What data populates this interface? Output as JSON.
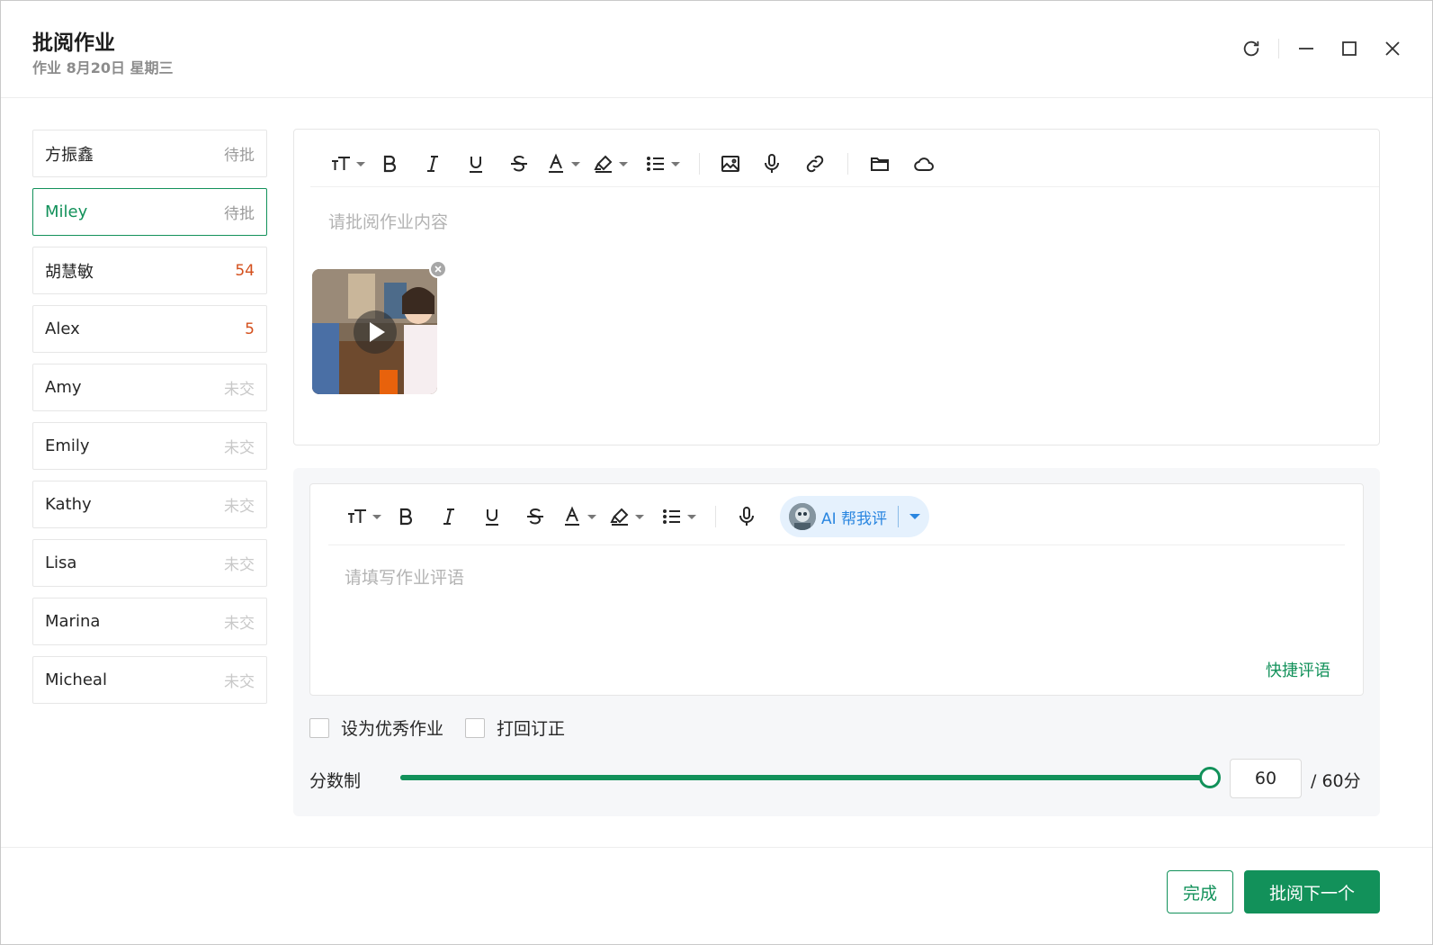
{
  "header": {
    "title": "批阅作业",
    "subtitle": "作业 8月20日 星期三"
  },
  "window_controls": [
    "refresh-icon",
    "minimize-icon",
    "maximize-icon",
    "close-icon"
  ],
  "students": [
    {
      "name": "方振鑫",
      "status": "待批",
      "kind": "pending"
    },
    {
      "name": "Miley",
      "status": "待批",
      "kind": "pending",
      "active": true
    },
    {
      "name": "胡慧敏",
      "status": "54",
      "kind": "score"
    },
    {
      "name": "Alex",
      "status": "5",
      "kind": "score"
    },
    {
      "name": "Amy",
      "status": "未交",
      "kind": "none"
    },
    {
      "name": "Emily",
      "status": "未交",
      "kind": "none"
    },
    {
      "name": "Kathy",
      "status": "未交",
      "kind": "none"
    },
    {
      "name": "Lisa",
      "status": "未交",
      "kind": "none"
    },
    {
      "name": "Marina",
      "status": "未交",
      "kind": "none"
    },
    {
      "name": "Micheal",
      "status": "未交",
      "kind": "none"
    }
  ],
  "content_editor": {
    "placeholder": "请批阅作业内容",
    "attachment": "video-thumbnail"
  },
  "comment_editor": {
    "placeholder": "请填写作业评语",
    "ai_button": "AI 帮我评",
    "quick_comments": "快捷评语"
  },
  "options": {
    "excellent": "设为优秀作业",
    "return_fix": "打回订正"
  },
  "score": {
    "label": "分数制",
    "value": "60",
    "max_label": "/ 60分",
    "fraction": 1.0
  },
  "footer": {
    "done": "完成",
    "next": "批阅下一个"
  },
  "colors": {
    "accent": "#12915a",
    "score": "#d4501d",
    "ai": "#2a86e0"
  }
}
